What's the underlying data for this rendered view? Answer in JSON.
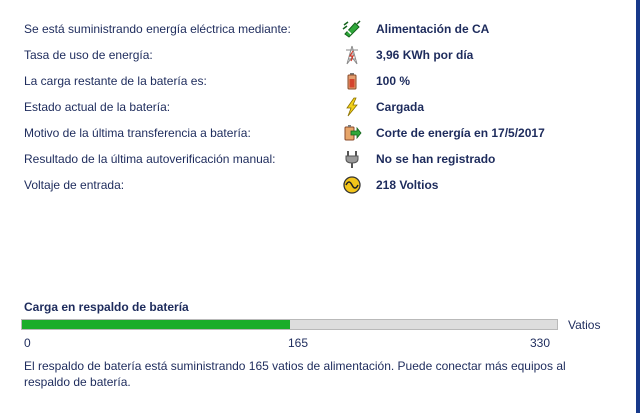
{
  "status_rows": [
    {
      "label": "Se está suministrando energía eléctrica mediante:",
      "icon": "ac-plug-icon",
      "value": "Alimentación de CA"
    },
    {
      "label": "Tasa de uso de energía:",
      "icon": "power-tower-icon",
      "value": "3,96 KWh por día"
    },
    {
      "label": "La carga restante de la batería es:",
      "icon": "battery-icon",
      "value": "100 %"
    },
    {
      "label": "Estado actual de la batería:",
      "icon": "lightning-icon",
      "value": "Cargada"
    },
    {
      "label": "Motivo de la última transferencia a batería:",
      "icon": "transfer-icon",
      "value": "Corte de energía en 17/5/2017"
    },
    {
      "label": "Resultado de la última autoverificación manual:",
      "icon": "plug-test-icon",
      "value": "No se han registrado"
    },
    {
      "label": "Voltaje de entrada:",
      "icon": "sine-wave-icon",
      "value": "218 Voltios"
    }
  ],
  "load": {
    "title": "Carga en respaldo de batería",
    "unit": "Vatios",
    "current_value": 165,
    "max_value": 330,
    "tick_labels": [
      "0",
      "165",
      "330"
    ],
    "description": "El respaldo de batería está suministrando 165 vatios de alimentación. Puede conectar más equipos al respaldo de batería.",
    "fill_color": "#1aad2a"
  }
}
